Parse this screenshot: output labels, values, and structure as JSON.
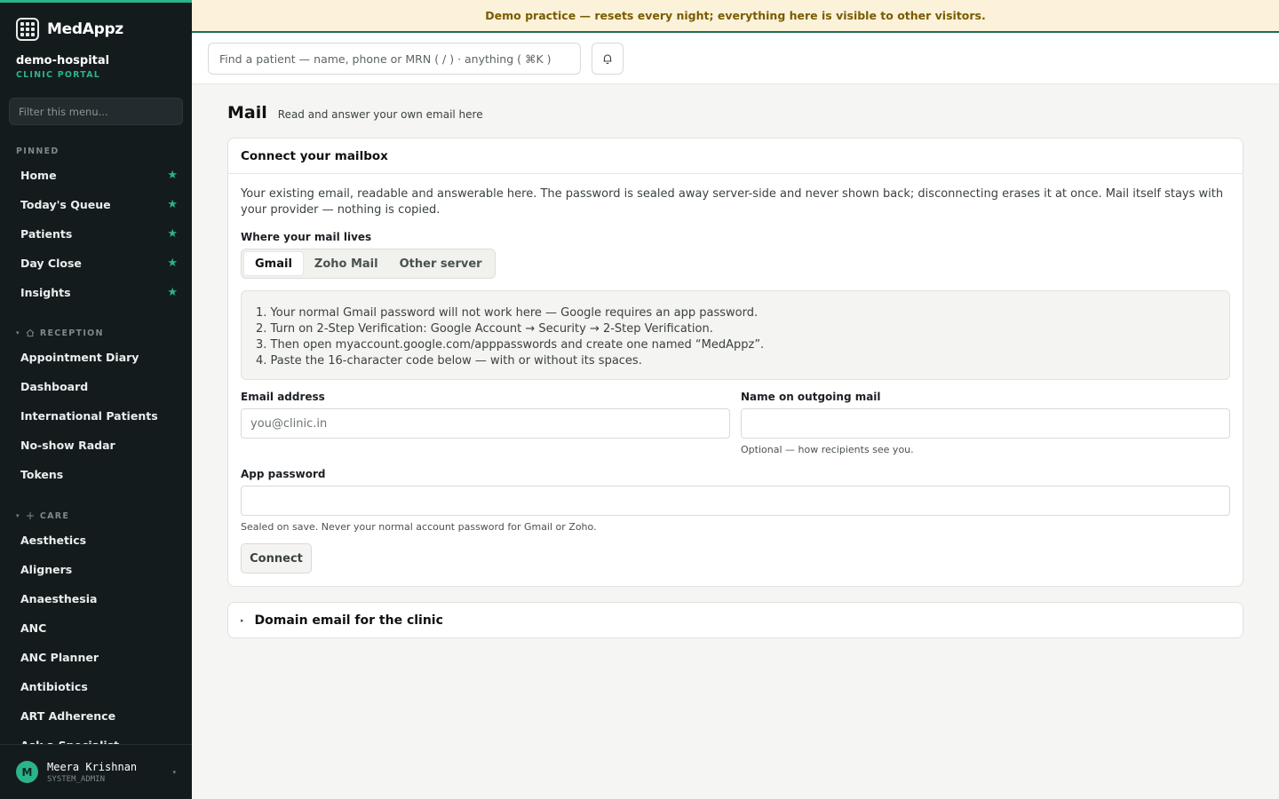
{
  "app": {
    "name": "MedAppz"
  },
  "org": {
    "name": "demo-hospital",
    "portal": "CLINIC PORTAL"
  },
  "sidebar": {
    "filter_placeholder": "Filter this menu...",
    "pinned_label": "PINNED",
    "pinned": [
      "Home",
      "Today's Queue",
      "Patients",
      "Day Close",
      "Insights"
    ],
    "reception_label": "RECEPTION",
    "reception": [
      "Appointment Diary",
      "Dashboard",
      "International Patients",
      "No-show Radar",
      "Tokens"
    ],
    "care_label": "CARE",
    "care": [
      "Aesthetics",
      "Aligners",
      "Anaesthesia",
      "ANC",
      "ANC Planner",
      "Antibiotics",
      "ART Adherence",
      "Ask a Specialist"
    ],
    "accent": "#2bb38a"
  },
  "user": {
    "initial": "M",
    "name": "Meera Krishnan",
    "role": "SYSTEM_ADMIN"
  },
  "banner": {
    "text": "Demo practice — resets every night; everything here is visible to other visitors."
  },
  "topbar": {
    "search_placeholder": "Find a patient — name, phone or MRN ( / ) · anything ( ⌘K )"
  },
  "page": {
    "title": "Mail",
    "subtitle": "Read and answer your own email here"
  },
  "connect": {
    "title": "Connect your mailbox",
    "description": "Your existing email, readable and answerable here. The password is sealed away server-side and never shown back; disconnecting erases it at once. Mail itself stays with your provider — nothing is copied.",
    "provider_label": "Where your mail lives",
    "providers": [
      "Gmail",
      "Zoho Mail",
      "Other server"
    ],
    "selected_provider": "Gmail",
    "steps": [
      "1. Your normal Gmail password will not work here — Google requires an app password.",
      "2. Turn on 2-Step Verification: Google Account → Security → 2-Step Verification.",
      "3. Then open myaccount.google.com/apppasswords and create one named “MedAppz”.",
      "4. Paste the 16-character code below — with or without its spaces."
    ],
    "email_label": "Email address",
    "email_placeholder": "you@clinic.in",
    "name_label": "Name on outgoing mail",
    "name_value": "",
    "name_hint": "Optional — how recipients see you.",
    "password_label": "App password",
    "password_value": "",
    "password_hint": "Sealed on save. Never your normal account password for Gmail or Zoho.",
    "connect_label": "Connect"
  },
  "domain_email": {
    "title": "Domain email for the clinic"
  }
}
